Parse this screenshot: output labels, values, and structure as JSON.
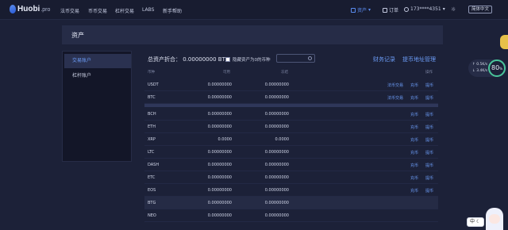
{
  "app": {
    "logo_name": "Huobi",
    "logo_suffix": ".pro"
  },
  "nav": [
    "法币交易",
    "币币交易",
    "杠杆交易",
    "LABS",
    "新手帮助"
  ],
  "header_right": {
    "assets": "资产",
    "orders": "订单",
    "user": "173****4351",
    "lang": "简体中文"
  },
  "page": {
    "title": "资产"
  },
  "sidebar": {
    "items": [
      {
        "label": "交易账户",
        "active": true
      },
      {
        "label": "杠杆账户",
        "active": false
      }
    ]
  },
  "summary": {
    "label": "总资产折合：",
    "value": "0.00000000",
    "unit": "BTC",
    "hide_small": "隐藏资产为0的币种",
    "search_placeholder": "",
    "links": {
      "finance": "财务记录",
      "withdraw_address": "提币地址管理"
    }
  },
  "table": {
    "headers": {
      "coin": "币种",
      "available": "可用",
      "frozen": "冻结",
      "ops": "操作"
    },
    "actions": {
      "fiat": "法币交易",
      "deposit": "充币",
      "withdraw": "提币"
    },
    "rows": [
      {
        "coin": "USDT",
        "available": "0.00000000",
        "frozen": "0.00000000"
      },
      {
        "coin": "BTC",
        "available": "0.00000000",
        "frozen": "0.00000000"
      },
      {
        "coin": "BCH",
        "available": "0.00000000",
        "frozen": "0.00000000"
      },
      {
        "coin": "ETH",
        "available": "0.00000000",
        "frozen": "0.00000000"
      },
      {
        "coin": "XRP",
        "available": "0.0000",
        "frozen": "0.0000"
      },
      {
        "coin": "LTC",
        "available": "0.00000000",
        "frozen": "0.00000000"
      },
      {
        "coin": "DASH",
        "available": "0.00000000",
        "frozen": "0.00000000"
      },
      {
        "coin": "ETC",
        "available": "0.00000000",
        "frozen": "0.00000000"
      },
      {
        "coin": "EOS",
        "available": "0.00000000",
        "frozen": "0.00000000"
      },
      {
        "coin": "BTG",
        "available": "0.00000000",
        "frozen": "0.00000000"
      },
      {
        "coin": "NEO",
        "available": "0.00000000",
        "frozen": "0.00000000"
      }
    ]
  },
  "widget": {
    "up_speed": "0.5",
    "up_unit": "K/s",
    "down_speed": "3.4",
    "down_unit": "K/s",
    "score": "80",
    "score_unit": "%"
  },
  "lang_switch": "中",
  "colors": {
    "background": "#1c2138",
    "accent": "#6b9bf5",
    "panel": "#262c47"
  }
}
